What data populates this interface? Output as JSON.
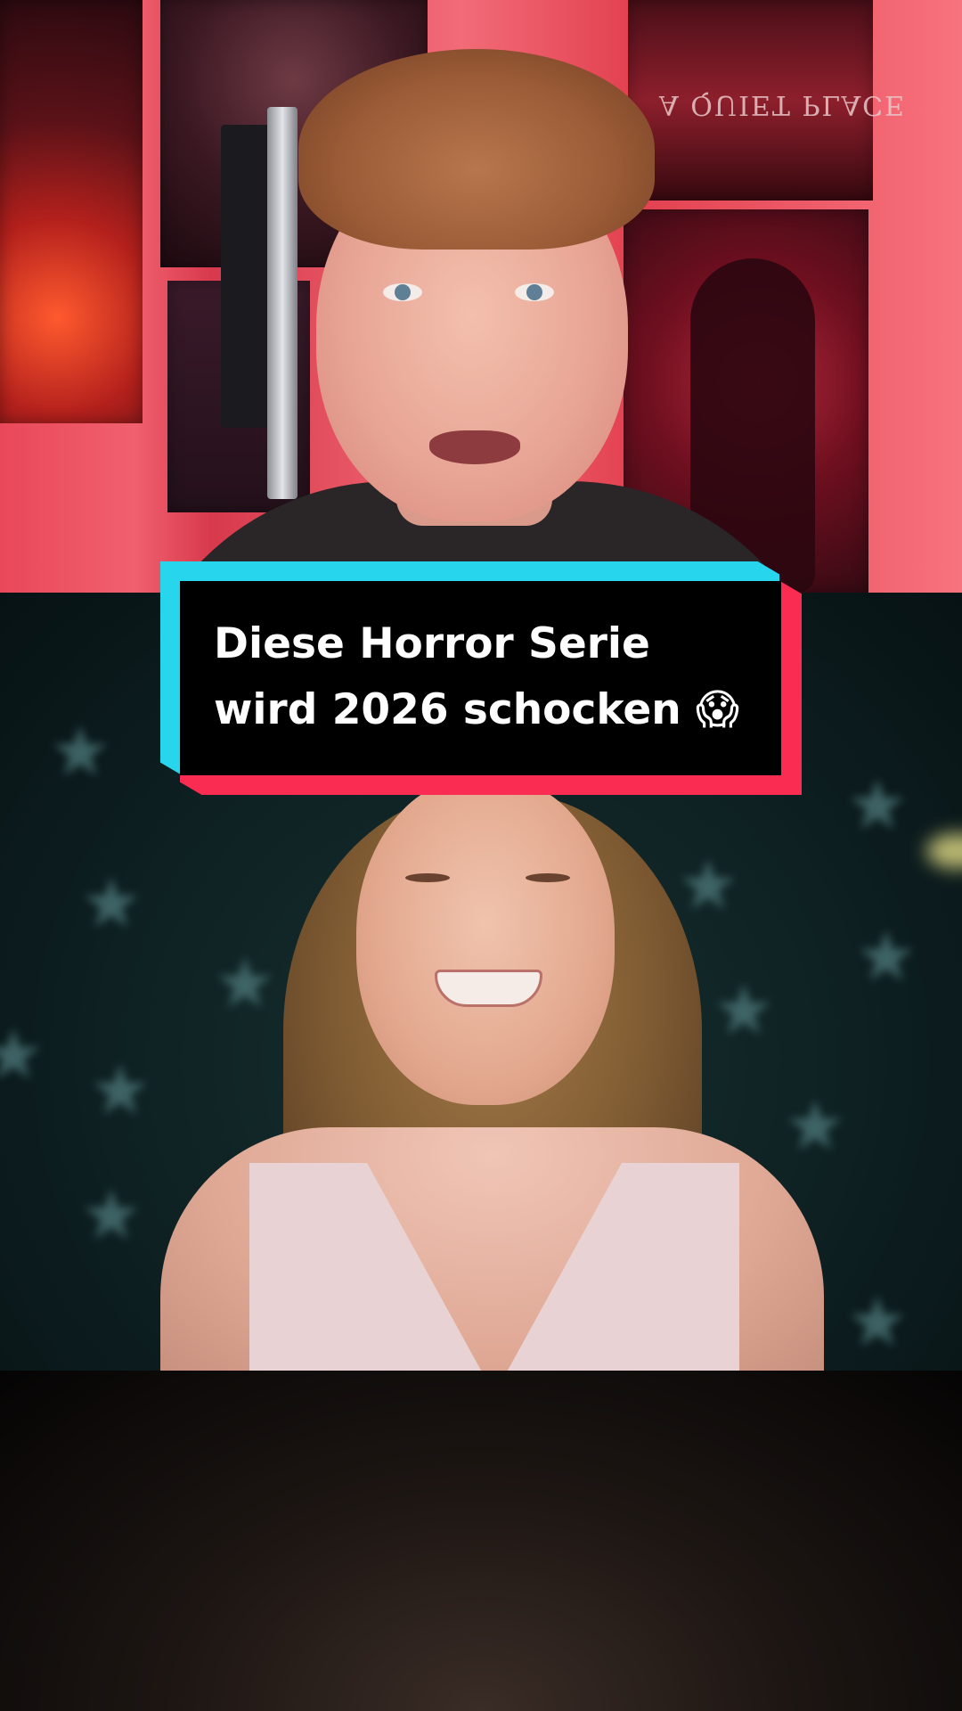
{
  "caption": {
    "line1": "Diese Horror Serie",
    "line2": "wird 2026 schocken 😱"
  },
  "background_poster_text": "A QUIET PLACE",
  "colors": {
    "caption_cyan": "#27d6ec",
    "caption_red": "#fb2c52",
    "caption_bg": "#000000",
    "caption_text": "#ffffff"
  }
}
